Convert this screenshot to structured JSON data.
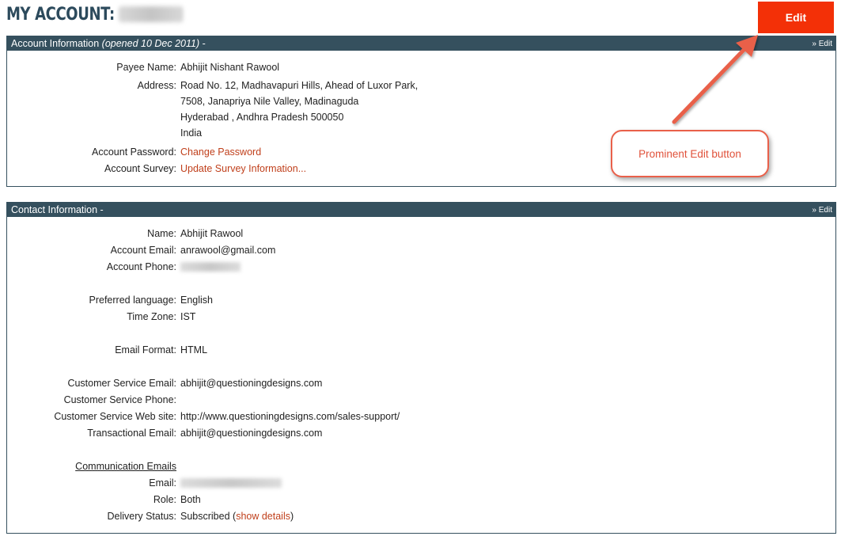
{
  "header": {
    "title": "MY ACCOUNT:",
    "edit_label": "Edit",
    "edit_color": "#f33007"
  },
  "account_info": {
    "title": "Account Information",
    "opened": "(opened 10 Dec 2011)",
    "suffix": " -",
    "edit_link": "» Edit",
    "payee_label": "Payee Name:",
    "payee_value": "Abhijit Nishant Rawool",
    "address_label": "Address:",
    "address_lines": [
      "Road No. 12, Madhavapuri Hills, Ahead of Luxor Park,",
      "7508, Janapriya Nile Valley, Madinaguda",
      "Hyderabad , Andhra Pradesh 500050",
      "India"
    ],
    "password_label": "Account Password:",
    "password_link": "Change Password",
    "survey_label": "Account Survey:",
    "survey_link": "Update Survey Information..."
  },
  "contact_info": {
    "title": "Contact Information -",
    "edit_link": "» Edit",
    "name_label": "Name:",
    "name_value": "Abhijit Rawool",
    "email_label": "Account Email:",
    "email_value": "anrawool@gmail.com",
    "phone_label": "Account Phone:",
    "language_label": "Preferred language:",
    "language_value": "English",
    "timezone_label": "Time Zone:",
    "timezone_value": "IST",
    "format_label": "Email Format:",
    "format_value": "HTML",
    "cs_email_label": "Customer Service Email:",
    "cs_email_value": "abhijit@questioningdesigns.com",
    "cs_phone_label": "Customer Service Phone:",
    "cs_web_label": "Customer Service Web site:",
    "cs_web_value": "http://www.questioningdesigns.com/sales-support/",
    "trans_email_label": "Transactional Email:",
    "trans_email_value": "abhijit@questioningdesigns.com",
    "comm_label": "Communication Emails",
    "comm_email_label": "Email:",
    "role_label": "Role:",
    "role_value": "Both",
    "delivery_label": "Delivery Status:",
    "delivery_value": "Subscribed (",
    "delivery_link": "show details",
    "delivery_close": ")"
  },
  "annotation": {
    "text": "Prominent Edit button",
    "color": "#e9604a"
  }
}
